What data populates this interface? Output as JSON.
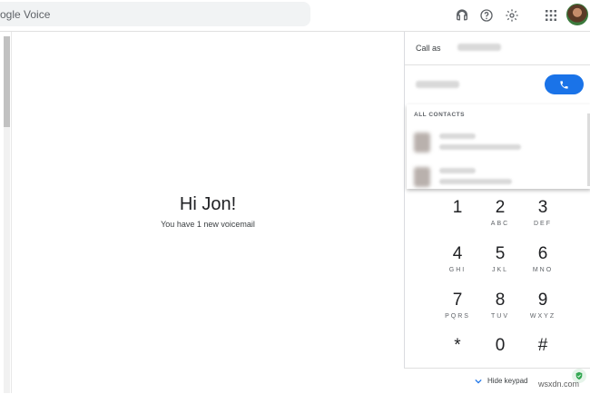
{
  "search": {
    "text": "ogle Voice"
  },
  "topbar_icons": [
    "headset-icon",
    "help-icon",
    "settings-icon",
    "apps-grid-icon",
    "avatar"
  ],
  "main": {
    "title": "Hi Jon!",
    "subtitle": "You have 1 new voicemail"
  },
  "panel": {
    "call_as_label": "Call as",
    "contacts_header": "ALL CONTACTS",
    "hide_keypad_label": "Hide keypad"
  },
  "keypad": [
    {
      "num": "1",
      "letters": ""
    },
    {
      "num": "2",
      "letters": "ABC"
    },
    {
      "num": "3",
      "letters": "DEF"
    },
    {
      "num": "4",
      "letters": "GHI"
    },
    {
      "num": "5",
      "letters": "JKL"
    },
    {
      "num": "6",
      "letters": "MNO"
    },
    {
      "num": "7",
      "letters": "PQRS"
    },
    {
      "num": "8",
      "letters": "TUV"
    },
    {
      "num": "9",
      "letters": "WXYZ"
    },
    {
      "num": "*",
      "letters": ""
    },
    {
      "num": "0",
      "letters": ""
    },
    {
      "num": "#",
      "letters": ""
    }
  ],
  "watermark": "wsxdn.com",
  "colors": {
    "accent": "#1a73e8",
    "text": "#202124",
    "muted": "#5f6368"
  }
}
